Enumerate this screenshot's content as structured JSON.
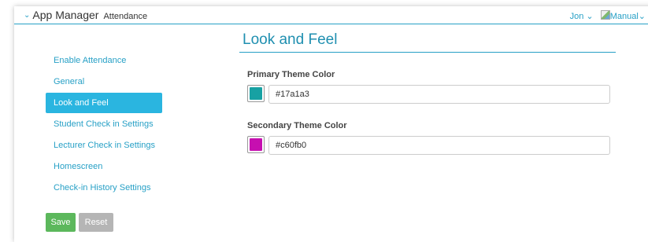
{
  "header": {
    "app_title": "App Manager",
    "subtitle": "Attendance",
    "user_menu": "Jon",
    "manual_menu": "Manual"
  },
  "page": {
    "title": "Look and Feel"
  },
  "sidebar": {
    "items": [
      {
        "label": "Enable Attendance",
        "active": false
      },
      {
        "label": "General",
        "active": false
      },
      {
        "label": "Look and Feel",
        "active": true
      },
      {
        "label": "Student Check in Settings",
        "active": false
      },
      {
        "label": "Lecturer Check in Settings",
        "active": false
      },
      {
        "label": "Homescreen",
        "active": false
      },
      {
        "label": "Check-in History Settings",
        "active": false
      }
    ]
  },
  "form": {
    "primary": {
      "label": "Primary Theme Color",
      "value": "#17a1a3",
      "swatch_color": "#17a1a3"
    },
    "secondary": {
      "label": "Secondary Theme Color",
      "value": "#c60fb0",
      "swatch_color": "#c60fb0"
    }
  },
  "actions": {
    "save_label": "Save",
    "reset_label": "Reset"
  },
  "colors": {
    "accent": "#27a0c6",
    "active_nav": "#2ab5e0",
    "save_button": "#5cb85c",
    "reset_button": "#b5b5b5"
  }
}
